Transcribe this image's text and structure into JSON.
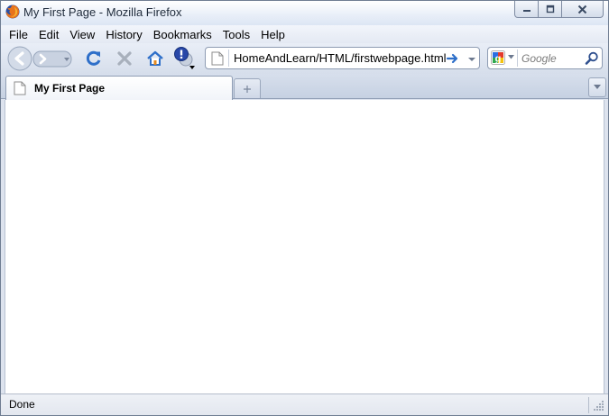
{
  "window": {
    "title": "My First Page - Mozilla Firefox"
  },
  "menu": [
    {
      "label": "File"
    },
    {
      "label": "Edit"
    },
    {
      "label": "View"
    },
    {
      "label": "History"
    },
    {
      "label": "Bookmarks"
    },
    {
      "label": "Tools"
    },
    {
      "label": "Help"
    }
  ],
  "toolbar": {
    "icons": [
      "back-icon",
      "forward-icon",
      "history-dropdown-icon",
      "reload-icon",
      "stop-icon",
      "home-icon",
      "addon-icon"
    ]
  },
  "urlbar": {
    "value": "HomeAndLearn/HTML/firstwebpage.html"
  },
  "search": {
    "placeholder": "Google",
    "engine_icon": "google-icon"
  },
  "tabs": [
    {
      "label": "My First Page",
      "active": true
    }
  ],
  "status": {
    "text": "Done"
  },
  "colors": {
    "accent_blue": "#2e6fc9",
    "chrome_bg": "#dde3ee",
    "stop_gray": "#a8b0bc"
  }
}
